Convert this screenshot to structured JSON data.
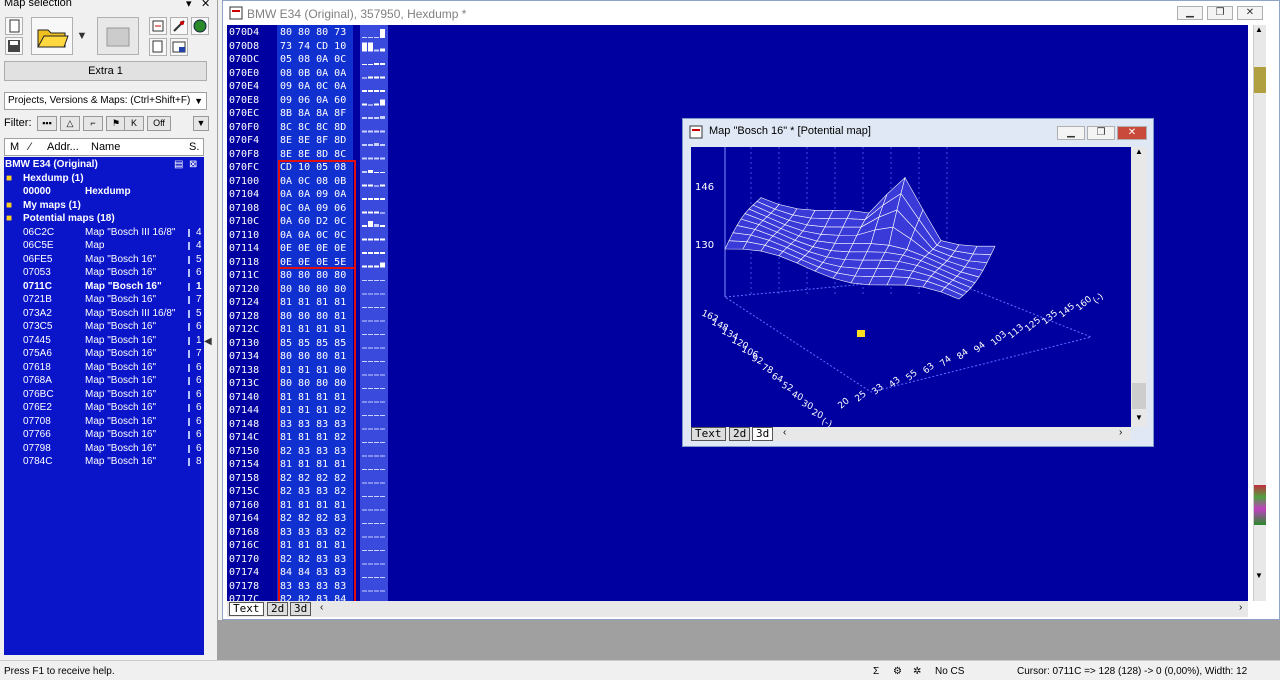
{
  "left_panel": {
    "title": "Map selection",
    "pin_label": "▾",
    "close_label": "✕",
    "extra_button": "Extra 1",
    "projects_select": "Projects, Versions & Maps:  (Ctrl+Shift+F)",
    "filter_label": "Filter:",
    "filter_off": "Off",
    "columns": {
      "m": "M",
      "sort": "⁄",
      "addr": "Addr...",
      "name": "Name",
      "s": "S."
    },
    "tree": [
      {
        "label": "BMW E34 (Original)",
        "bold": true
      },
      {
        "label": "Hexdump (1)",
        "bold": true,
        "folder": true
      },
      {
        "addr": "00000",
        "name": "Hexdump",
        "bold": true
      },
      {
        "label": "My maps (1)",
        "bold": true,
        "folder": true
      },
      {
        "label": "Potential maps (18)",
        "bold": true,
        "folder": true
      }
    ],
    "maps": [
      {
        "addr": "06C2C",
        "name": "Map \"Bosch III 16/8\"",
        "s": "4"
      },
      {
        "addr": "06C5E",
        "name": "Map",
        "s": "4"
      },
      {
        "addr": "06FE5",
        "name": "Map \"Bosch 16\"",
        "s": "5"
      },
      {
        "addr": "07053",
        "name": "Map \"Bosch 16\"",
        "s": "6"
      },
      {
        "addr": "0711C",
        "name": "Map \"Bosch 16\"",
        "s": "1",
        "bold": true
      },
      {
        "addr": "0721B",
        "name": "Map \"Bosch 16\"",
        "s": "7"
      },
      {
        "addr": "073A2",
        "name": "Map \"Bosch III 16/8\"",
        "s": "5"
      },
      {
        "addr": "073C5",
        "name": "Map \"Bosch 16\"",
        "s": "6"
      },
      {
        "addr": "07445",
        "name": "Map \"Bosch 16\"",
        "s": "1"
      },
      {
        "addr": "075A6",
        "name": "Map \"Bosch 16\"",
        "s": "7"
      },
      {
        "addr": "07618",
        "name": "Map \"Bosch 16\"",
        "s": "6"
      },
      {
        "addr": "0768A",
        "name": "Map \"Bosch 16\"",
        "s": "6"
      },
      {
        "addr": "076BC",
        "name": "Map \"Bosch 16\"",
        "s": "6"
      },
      {
        "addr": "076E2",
        "name": "Map \"Bosch 16\"",
        "s": "6"
      },
      {
        "addr": "07708",
        "name": "Map \"Bosch 16\"",
        "s": "6"
      },
      {
        "addr": "07766",
        "name": "Map \"Bosch 16\"",
        "s": "6"
      },
      {
        "addr": "07798",
        "name": "Map \"Bosch 16\"",
        "s": "6"
      },
      {
        "addr": "0784C",
        "name": "Map \"Bosch 16\"",
        "s": "8"
      }
    ]
  },
  "hex_window": {
    "title": "BMW E34 (Original), 357950, Hexdump *",
    "tabs": [
      "Text",
      "2d",
      "3d"
    ],
    "rows": [
      {
        "addr": "070D4",
        "hex": "80 80 80 73"
      },
      {
        "addr": "070D8",
        "hex": "73 74 CD 10"
      },
      {
        "addr": "070DC",
        "hex": "05 08 0A 0C"
      },
      {
        "addr": "070E0",
        "hex": "08 0B 0A 0A"
      },
      {
        "addr": "070E4",
        "hex": "09 0A 0C 0A"
      },
      {
        "addr": "070E8",
        "hex": "09 06 0A 60"
      },
      {
        "addr": "070EC",
        "hex": "8B 8A 8A 8F"
      },
      {
        "addr": "070F0",
        "hex": "8C 8C 8C 8D"
      },
      {
        "addr": "070F4",
        "hex": "8E 8E 8F 8D"
      },
      {
        "addr": "070F8",
        "hex": "8E 8E 8D 8C"
      },
      {
        "addr": "070FC",
        "hex": "CD 10 05 08"
      },
      {
        "addr": "07100",
        "hex": "0A 0C 08 0B"
      },
      {
        "addr": "07104",
        "hex": "0A 0A 09 0A"
      },
      {
        "addr": "07108",
        "hex": "0C 0A 09 06"
      },
      {
        "addr": "0710C",
        "hex": "0A 60 D2 0C"
      },
      {
        "addr": "07110",
        "hex": "0A 0A 0C 0C"
      },
      {
        "addr": "07114",
        "hex": "0E 0E 0E 0E"
      },
      {
        "addr": "07118",
        "hex": "0E 0E 0E 5E"
      },
      {
        "addr": "0711C",
        "hex": "80 80 80 80"
      },
      {
        "addr": "07120",
        "hex": "80 80 80 80"
      },
      {
        "addr": "07124",
        "hex": "81 81 81 81"
      },
      {
        "addr": "07128",
        "hex": "80 80 80 81"
      },
      {
        "addr": "0712C",
        "hex": "81 81 81 81"
      },
      {
        "addr": "07130",
        "hex": "85 85 85 85"
      },
      {
        "addr": "07134",
        "hex": "80 80 80 81"
      },
      {
        "addr": "07138",
        "hex": "81 81 81 80"
      },
      {
        "addr": "0713C",
        "hex": "80 80 80 80"
      },
      {
        "addr": "07140",
        "hex": "81 81 81 81"
      },
      {
        "addr": "07144",
        "hex": "81 81 81 82"
      },
      {
        "addr": "07148",
        "hex": "83 83 83 83"
      },
      {
        "addr": "0714C",
        "hex": "81 81 81 82"
      },
      {
        "addr": "07150",
        "hex": "82 83 83 83"
      },
      {
        "addr": "07154",
        "hex": "81 81 81 81"
      },
      {
        "addr": "07158",
        "hex": "82 82 82 82"
      },
      {
        "addr": "0715C",
        "hex": "82 83 83 82"
      },
      {
        "addr": "07160",
        "hex": "81 81 81 81"
      },
      {
        "addr": "07164",
        "hex": "82 82 82 83"
      },
      {
        "addr": "07168",
        "hex": "83 83 83 82"
      },
      {
        "addr": "0716C",
        "hex": "81 81 81 81"
      },
      {
        "addr": "07170",
        "hex": "82 82 83 83"
      },
      {
        "addr": "07174",
        "hex": "84 84 83 83"
      },
      {
        "addr": "07178",
        "hex": "83 83 83 83"
      },
      {
        "addr": "0717C",
        "hex": "82 82 83 84"
      }
    ]
  },
  "map_window": {
    "title": "Map \"Bosch 16\" *  [Potential map]",
    "tabs": [
      "Text",
      "2d",
      "3d"
    ],
    "z_labels": [
      "146",
      "130"
    ],
    "y_axis_labels": [
      "162",
      "148",
      "134",
      "120",
      "106",
      "92",
      "78",
      "64",
      "52",
      "40",
      "30",
      "20",
      "(-)"
    ],
    "x_axis_labels": [
      "20",
      "25",
      "33",
      "43",
      "55",
      "63",
      "74",
      "84",
      "94",
      "103",
      "113",
      "125",
      "135",
      "145",
      "160",
      "(-)"
    ]
  },
  "status_bar": {
    "help": "Press F1 to receive help.",
    "cs": "No CS",
    "cursor": "Cursor: 0711C => 128 (128) ->   0 (0,00%), Width: 12"
  },
  "colors": {
    "hex_bg": "#0000a0",
    "selection": "#e01010",
    "list_bg": "#0a14c8"
  }
}
